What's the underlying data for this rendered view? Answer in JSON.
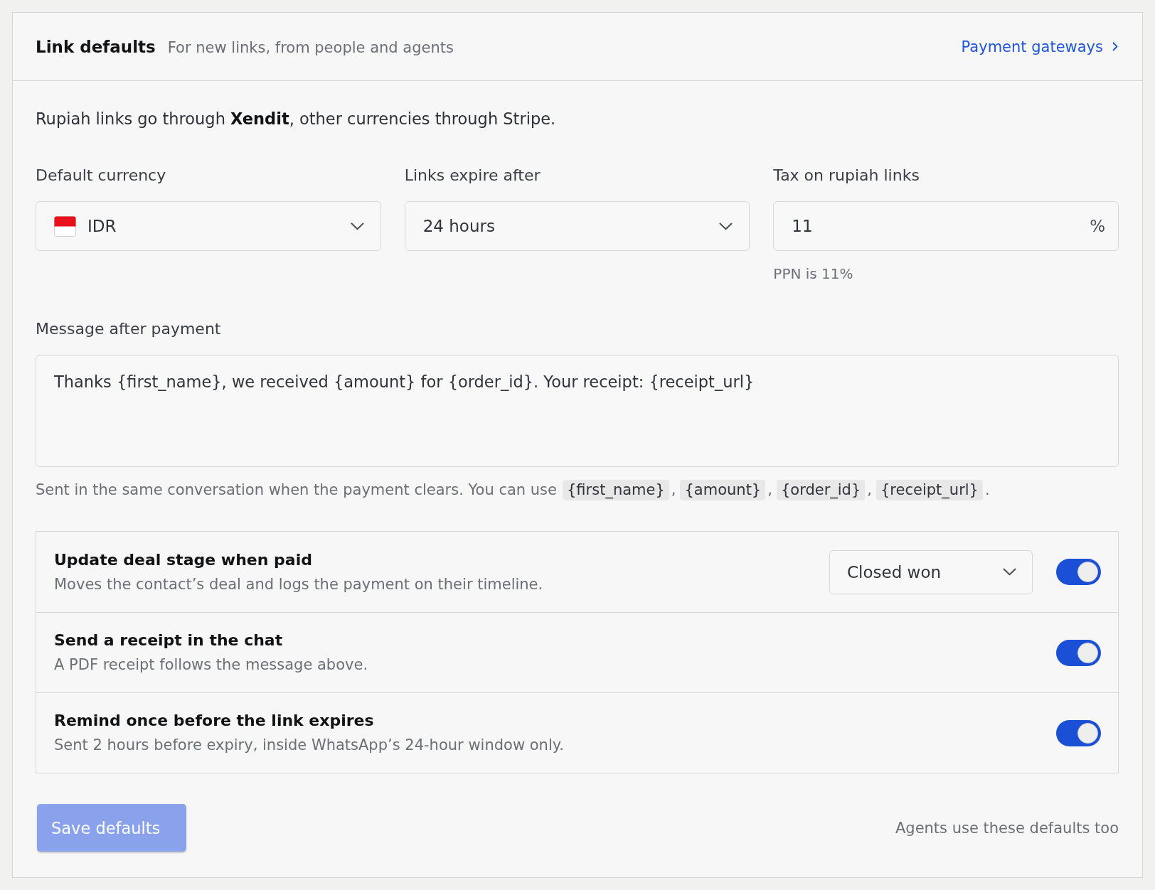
{
  "header": {
    "title": "Link defaults",
    "subtitle": "For new links, from people and agents",
    "link": "Payment gateways"
  },
  "intro": "Rupiah links go through **Xendit**, other currencies through Stripe.",
  "fields": [
    {
      "kind": "currency",
      "label": "Default currency",
      "value": "IDR"
    },
    {
      "kind": "select",
      "label": "Links expire after",
      "value": "24 hours"
    },
    {
      "kind": "percent",
      "label": "Tax on rupiah links",
      "value": "11",
      "suffix": "%",
      "hint": "PPN is 11%"
    }
  ],
  "message": {
    "label": "Message after payment",
    "value": "Thanks {first_name}, we received {amount} for {order_id}. Your receipt: {receipt_url}",
    "help": {
      "text": "Sent in the same conversation when the payment clears. You can use",
      "variables": [
        "{first_name}",
        "{amount}",
        "{order_id}",
        "{receipt_url}"
      ],
      "separator": ",",
      "end": "."
    }
  },
  "options": [
    {
      "kind": "select",
      "title": "Update deal stage when paid",
      "description": "Moves the contact’s deal and logs the payment on their timeline.",
      "value": "Closed won",
      "on": true
    },
    {
      "kind": "toggle",
      "title": "Send a receipt in the chat",
      "description": "A PDF receipt follows the message above.",
      "on": true
    },
    {
      "kind": "toggle",
      "title": "Remind once before the link expires",
      "description": "Sent 2 hours before expiry, inside WhatsApp’s 24-hour window only.",
      "on": true
    }
  ],
  "footer": {
    "button": {
      "label": "Save defaults",
      "disabled": true
    },
    "note": "Agents use these defaults too"
  }
}
